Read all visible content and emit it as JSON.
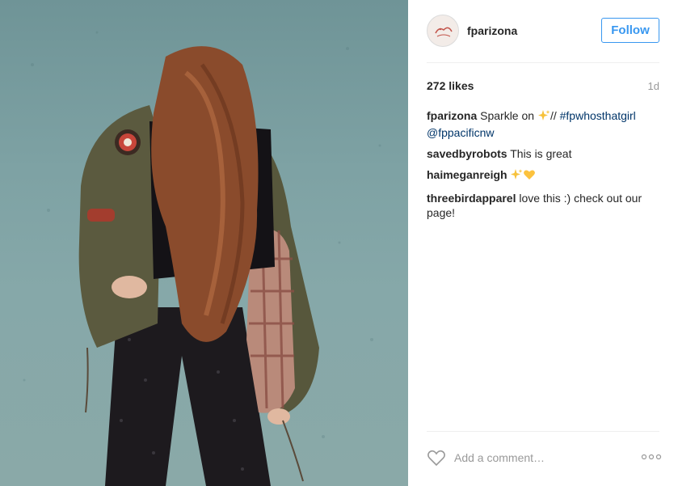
{
  "post": {
    "username": "fparizona",
    "follow_label": "Follow",
    "likes": "272 likes",
    "age": "1d"
  },
  "caption": {
    "author": "fparizona",
    "text_before": "Sparkle on ",
    "text_after": "// ",
    "hashtag": "#fpwhosthatgirl",
    "mention": "@fppacificnw"
  },
  "comments": [
    {
      "author": "savedbyrobots",
      "text": "This is great"
    },
    {
      "author": "haimeganreigh",
      "text": ""
    },
    {
      "author": "threebirdapparel",
      "text": "love this :) check out our page!"
    }
  ],
  "comment_box": {
    "placeholder": "Add a comment…"
  },
  "icons": {
    "avatar": "fp-logo-avatar",
    "like": "heart-outline-icon",
    "sparkles": "sparkles-emoji",
    "heart_emoji": "yellow-heart-emoji",
    "more": "more-options-icon"
  },
  "colors": {
    "accent": "#3897f0",
    "link": "#003569",
    "muted": "#999999",
    "wall": "#7ea2a4"
  }
}
